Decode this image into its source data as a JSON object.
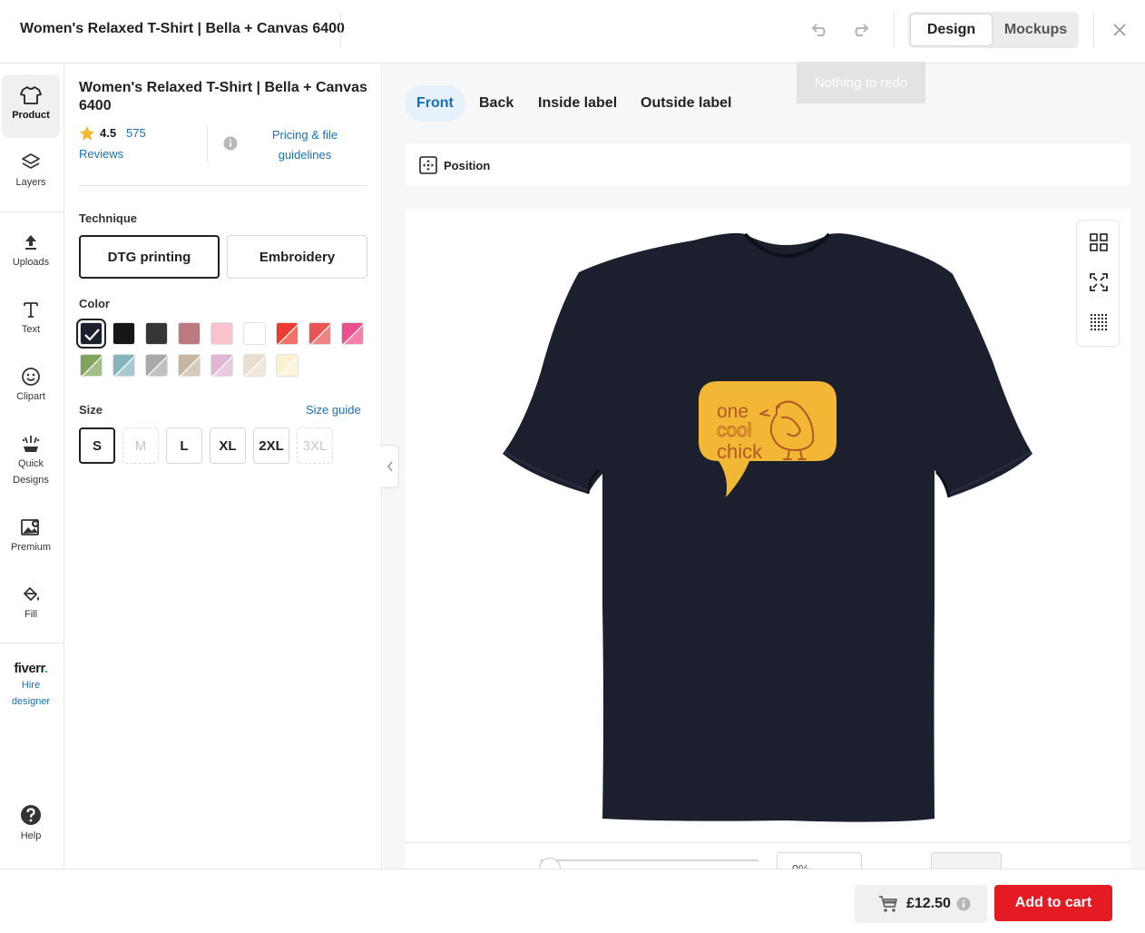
{
  "header": {
    "title": "Women's Relaxed T-Shirt | Bella + Canvas 6400",
    "modes": [
      "Design",
      "Mockups"
    ],
    "active_mode": "Design",
    "redo_tooltip": "Nothing to redo"
  },
  "rail": {
    "items": [
      {
        "label": "Product",
        "icon": "tshirt-icon"
      },
      {
        "label": "Layers",
        "icon": "layers-icon"
      },
      {
        "label": "Uploads",
        "icon": "upload-icon"
      },
      {
        "label": "Text",
        "icon": "text-icon"
      },
      {
        "label": "Clipart",
        "icon": "smiley-icon"
      },
      {
        "label": "Quick Designs",
        "icon": "quick-designs-icon"
      },
      {
        "label": "Premium",
        "icon": "premium-image-icon"
      },
      {
        "label": "Fill",
        "icon": "paint-bucket-icon"
      },
      {
        "label": "Hire designer",
        "icon": "fiverr-logo"
      },
      {
        "label": "Help",
        "icon": "help-icon"
      }
    ],
    "fiverr_word": "fiverr",
    "fiverr_dot": "."
  },
  "product": {
    "title": "Women's Relaxed T-Shirt | Bella + Canvas 6400",
    "rating": "4.5",
    "review_count": "575",
    "reviews_label": "Reviews",
    "pricing_link": "Pricing & file guidelines",
    "technique_label": "Technique",
    "techniques": [
      "DTG printing",
      "Embroidery"
    ],
    "selected_technique": "DTG printing",
    "color_label": "Color",
    "colors": [
      {
        "hex": "#1c1f2e",
        "kind": "solid",
        "selected": true
      },
      {
        "hex": "#161616",
        "kind": "solid"
      },
      {
        "hex": "#363636",
        "kind": "solid"
      },
      {
        "hex": "#bb7a7f",
        "kind": "solid"
      },
      {
        "hex": "#fac1cf",
        "kind": "solid"
      },
      {
        "hex": "#ffffff",
        "kind": "solid"
      },
      {
        "hex": "#ef3a2f",
        "kind": "heather"
      },
      {
        "hex": "#ea5455",
        "kind": "heather"
      },
      {
        "hex": "#ec4f8d",
        "kind": "heather"
      },
      {
        "hex": "#7ea55b",
        "kind": "heather"
      },
      {
        "hex": "#85b6be",
        "kind": "heather"
      },
      {
        "hex": "#a9a9ab",
        "kind": "heather"
      },
      {
        "hex": "#c7b5a1",
        "kind": "heather"
      },
      {
        "hex": "#e1b6d4",
        "kind": "heather"
      },
      {
        "hex": "#e9dfd0",
        "kind": "heather"
      },
      {
        "hex": "#fbf1cd",
        "kind": "heather"
      }
    ],
    "size_label": "Size",
    "size_guide": "Size guide",
    "sizes": [
      {
        "label": "S",
        "state": "selected"
      },
      {
        "label": "M",
        "state": "disabled"
      },
      {
        "label": "L",
        "state": "normal"
      },
      {
        "label": "XL",
        "state": "normal"
      },
      {
        "label": "2XL",
        "state": "normal"
      },
      {
        "label": "3XL",
        "state": "disabled"
      }
    ]
  },
  "main": {
    "tabs": [
      "Front",
      "Back",
      "Inside label",
      "Outside label"
    ],
    "active_tab": "Front",
    "position_label": "Position",
    "shirt_color": "#1c1f2e",
    "design": {
      "bubble_color": "#f2b835",
      "text_color": "#b35a27",
      "lines": [
        "one",
        "cool",
        "chick"
      ]
    },
    "zoom_value": "0%"
  },
  "footer": {
    "price": "£12.50",
    "add_to_cart": "Add to cart",
    "accent": "#e51b23"
  }
}
